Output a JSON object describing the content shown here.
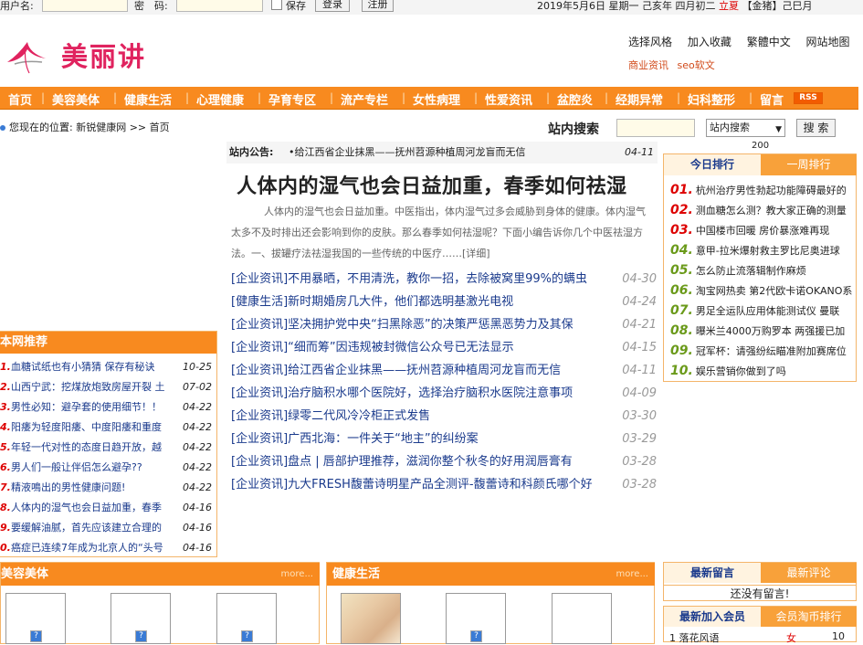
{
  "topbar": {
    "user_label": "用户名:",
    "pwd_label": "密　码:",
    "save_label": "保存",
    "login_btn": "登录",
    "register_btn": "注册",
    "date": "2019年5月6日  星期一   己亥年  四月初二",
    "solar_term": "立夏",
    "jinzhu": "【金猪】己巳月"
  },
  "header": {
    "logo_text": "美丽讲",
    "links": [
      "选择风格",
      "加入收藏",
      "繁體中文",
      "网站地图"
    ],
    "links2": [
      "商业资讯",
      "seo软文"
    ]
  },
  "nav": {
    "items": [
      "首页",
      "美容美体",
      "健康生活",
      "心理健康",
      "孕育专区",
      "流产专栏",
      "女性病理",
      "性爱资讯",
      "盆腔炎",
      "经期异常",
      "妇科整形",
      "留言"
    ],
    "rss": "RSS"
  },
  "location": {
    "prefix": "您现在的位置:",
    "site": "新锐健康网",
    "sep": ">>",
    "page": "首页"
  },
  "search": {
    "label": "站内搜索",
    "select_value": "站内搜索",
    "button": "搜 索",
    "count": "200"
  },
  "notice": {
    "title": "站内公告:",
    "text": "•给江西省企业抹黑——抚州苕源种植周河龙盲而无信",
    "date": "04-11"
  },
  "headline": {
    "title": "人体内的湿气也会日益加重，春季如何祛湿",
    "summary": "人体内的湿气也会日益加重。中医指出，体内湿气过多会威胁到身体的健康。体内湿气太多不及时排出还会影响到你的皮肤。那么春季如何祛湿呢？下面小编告诉你几个中医祛湿方法。一、拔罐疗法祛湿我国的一些传统的中医疗……[详细]"
  },
  "news": [
    {
      "title": "[企业资讯]不用暴晒，不用清洗，教你一招，去除被窝里99%的螨虫",
      "date": "04-30"
    },
    {
      "title": "[健康生活]新时期婚房几大件，他们都选明基激光电视",
      "date": "04-24"
    },
    {
      "title": "[企业资讯]坚决拥护党中央“扫黑除恶”的决策严惩黑恶势力及其保",
      "date": "04-21"
    },
    {
      "title": "[企业资讯]“细而筹”因违规被封微信公众号已无法显示",
      "date": "04-15"
    },
    {
      "title": "[企业资讯]给江西省企业抹黑——抚州苕源种植周河龙盲而无信",
      "date": "04-11"
    },
    {
      "title": "[企业资讯]治疗脑积水哪个医院好，选择治疗脑积水医院注意事项",
      "date": "04-09"
    },
    {
      "title": "[企业资讯]绿零二代风冷冷柜正式发售",
      "date": "03-30"
    },
    {
      "title": "[企业资讯]广西北海：一件关于“地主”的纠纷案",
      "date": "03-29"
    },
    {
      "title": "[企业资讯]盘点 | 唇部护理推荐，滋润你整个秋冬的好用润唇膏有",
      "date": "03-28"
    },
    {
      "title": "[企业资讯]九大FRESH馥蕾诗明星产品全测评-馥蕾诗和科颜氏哪个好",
      "date": "03-28"
    }
  ],
  "recommend": {
    "title": "本网推荐",
    "items": [
      {
        "n": "1.",
        "title": "血糖试纸也有小猜猜 保存有秘诀",
        "date": "10-25"
      },
      {
        "n": "2.",
        "title": "山西宁武：挖煤放炮致房屋开裂 土",
        "date": "07-02"
      },
      {
        "n": "3.",
        "title": "男性必知：避孕套的使用细节！！",
        "date": "04-22"
      },
      {
        "n": "4.",
        "title": "阳痿为轻度阳痿、中度阳痿和重度",
        "date": "04-22"
      },
      {
        "n": "5.",
        "title": "年轻一代对性的态度日趋开放，越",
        "date": "04-22"
      },
      {
        "n": "6.",
        "title": "男人们一般让伴侣怎么避孕??",
        "date": "04-22"
      },
      {
        "n": "7.",
        "title": "精液鳴出的男性健康问题!",
        "date": "04-22"
      },
      {
        "n": "8.",
        "title": "人体内的湿气也会日益加重，春季",
        "date": "04-16"
      },
      {
        "n": "9.",
        "title": "要缓解油腻，首先应该建立合理的",
        "date": "04-16"
      },
      {
        "n": "0.",
        "title": "癌症已连续7年成为北京人的“头号",
        "date": "04-16"
      }
    ]
  },
  "ranking": {
    "tab1": "今日排行",
    "tab2": "一周排行",
    "items": [
      {
        "n": "01.",
        "title": "杭州治疗男性勃起功能障碍最好的",
        "color": "#d00"
      },
      {
        "n": "02.",
        "title": "测血糖怎么测？教大家正确的测量",
        "color": "#d00"
      },
      {
        "n": "03.",
        "title": "中国楼市回暖 房价暴涨难再现",
        "color": "#d00"
      },
      {
        "n": "04.",
        "title": "意甲-拉米爆射救主罗比尼奥进球",
        "color": "#6a9a1a"
      },
      {
        "n": "05.",
        "title": "怎么防止流落辑制作麻烦",
        "color": "#6a9a1a"
      },
      {
        "n": "06.",
        "title": "淘宝网热卖 第2代欧卡诺OKANO系",
        "color": "#6a9a1a"
      },
      {
        "n": "07.",
        "title": "男足全运队应用体能测试仪 曼联",
        "color": "#6a9a1a"
      },
      {
        "n": "08.",
        "title": "曝米兰4000万购罗本 两强援已加",
        "color": "#6a9a1a"
      },
      {
        "n": "09.",
        "title": "冠军杯：请强纷纭瞄准附加赛席位",
        "color": "#6a9a1a"
      },
      {
        "n": "10.",
        "title": "娱乐营销你做到了吗",
        "color": "#6a9a1a"
      }
    ]
  },
  "sections": {
    "beauty": {
      "title": "美容美体",
      "more": "more..."
    },
    "health": {
      "title": "健康生活",
      "more": "more..."
    }
  },
  "messages": {
    "tab1": "最新留言",
    "tab2": "最新评论",
    "empty": "还没有留言!"
  },
  "members": {
    "tab1": "最新加入会员",
    "tab2": "会员淘币排行",
    "row_name": "1 落花风语",
    "row_gender": "女",
    "row_count": "10"
  },
  "colors": {
    "accent": "#f88a1f",
    "brand": "#e0235f",
    "link": "#1a3a8c"
  }
}
